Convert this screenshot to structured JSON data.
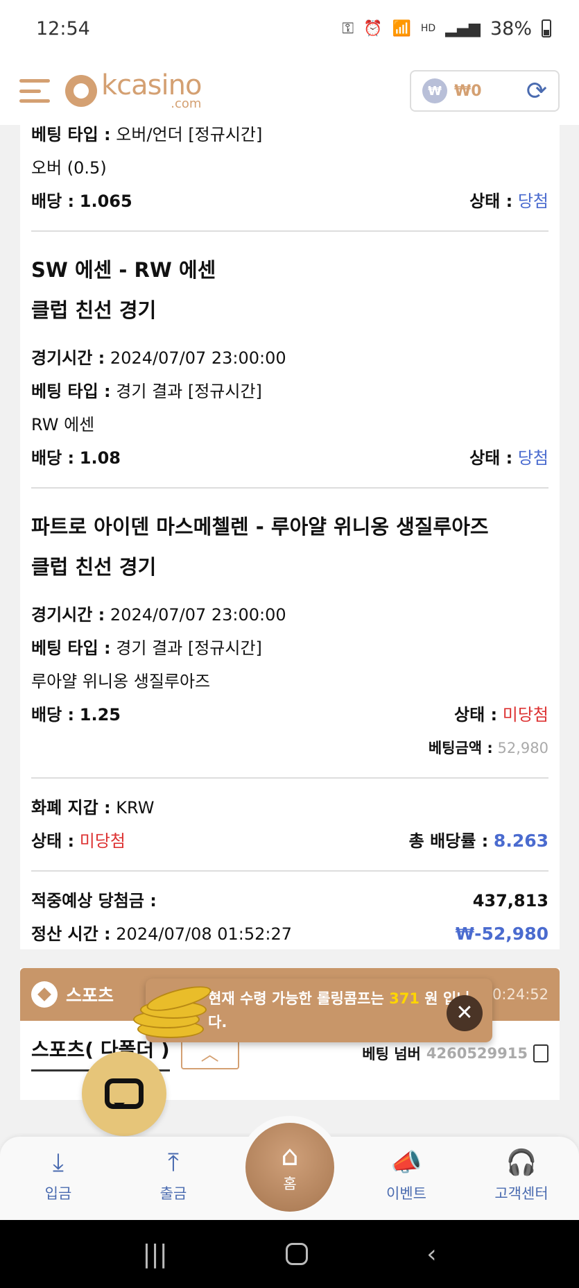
{
  "status_bar": {
    "time": "12:54",
    "battery": "38%",
    "hd": "HD"
  },
  "header": {
    "brand": "kcasino",
    "brand_domain": ".com",
    "balance": "₩0",
    "won_symbol": "₩"
  },
  "bet_partial": {
    "bet_type_label": "베팅 타입 :",
    "bet_type": "오버/언더 [정규시간]",
    "pick": "오버 (0.5)",
    "odds_label": "배당 :",
    "odds": "1.065",
    "status_label": "상태 :",
    "status": "당첨"
  },
  "bets": [
    {
      "title": "SW 에센 - RW 에센",
      "subtitle": "클럽 친선 경기",
      "time_label": "경기시간 :",
      "time": "2024/07/07 23:00:00",
      "bet_type_label": "베팅 타입 :",
      "bet_type": "경기 결과 [정규시간]",
      "pick": "RW 에센",
      "odds_label": "배당 :",
      "odds": "1.08",
      "status_label": "상태 :",
      "status": "당첨"
    },
    {
      "title": "파트로 아이덴 마스메첼렌 - 루아얄 위니옹 생질루아즈",
      "subtitle": "클럽 친선 경기",
      "time_label": "경기시간 :",
      "time": "2024/07/07 23:00:00",
      "bet_type_label": "베팅 타입 :",
      "bet_type": "경기 결과 [정규시간]",
      "pick": "루아얄 위니옹 생질루아즈",
      "odds_label": "배당 :",
      "odds": "1.25",
      "status_label": "상태 :",
      "status": "미당첨",
      "stake_label": "베팅금액 :",
      "stake": "52,980"
    }
  ],
  "summary": {
    "wallet_label": "화폐 지갑 :",
    "wallet": "KRW",
    "status_label": "상태 :",
    "status": "미당첨",
    "total_odds_label": "총 배당률 :",
    "total_odds": "8.263",
    "expected_label": "적중예상 당첨금 :",
    "expected": "437,813",
    "settle_label": "정산 시간 :",
    "settle_time": "2024/07/08 01:52:27",
    "settle_amount": "₩-52,980"
  },
  "sports_card": {
    "label": "스포츠",
    "date": "...07 00:24:52",
    "tab": "스포츠( 다폴더 )",
    "bet_number_label": "베팅 넘버",
    "bet_number": "4260529915"
  },
  "toast": {
    "text_before": "현재 수령 가능한 롤링콤프는 ",
    "amount": "371",
    "text_after": " 원 입니다."
  },
  "bottom_nav": {
    "deposit": "입금",
    "withdraw": "출금",
    "home": "홈",
    "event": "이벤트",
    "support": "고객센터"
  },
  "colors": {
    "accent": "#d4a072",
    "win": "#4a6bcf",
    "lose": "#d33333",
    "toast": "#c89669"
  }
}
